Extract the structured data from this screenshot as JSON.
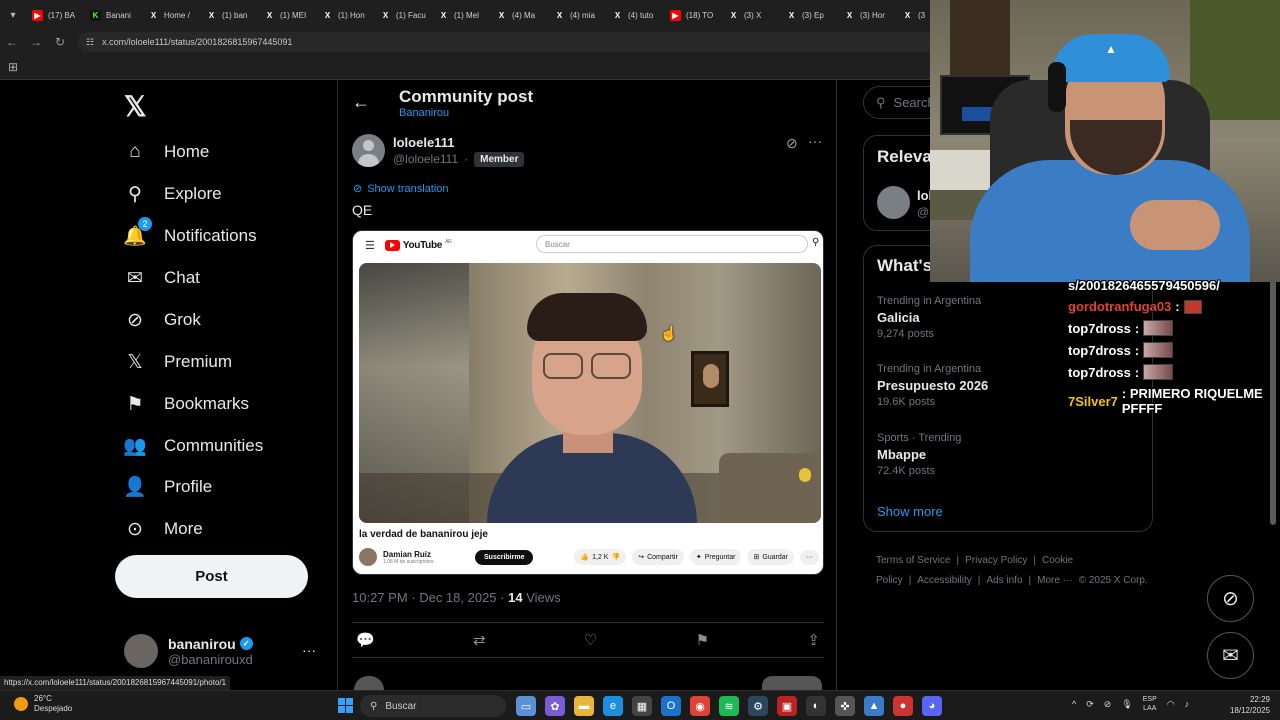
{
  "browser": {
    "tabs": [
      {
        "label": "(17) BA",
        "icon": "youtube-icon",
        "color": "#ff0000"
      },
      {
        "label": "Banani",
        "icon": "kick-icon",
        "color": "#53fc18"
      },
      {
        "label": "Home /",
        "icon": "x-icon",
        "color": "#000000"
      },
      {
        "label": "(1) ban",
        "icon": "x-icon",
        "color": "#000000"
      },
      {
        "label": "(1) MEI",
        "icon": "x-icon",
        "color": "#000000"
      },
      {
        "label": "(1) Hon",
        "icon": "x-icon",
        "color": "#000000"
      },
      {
        "label": "(1) Facu",
        "icon": "x-icon",
        "color": "#000000"
      },
      {
        "label": "(1) Mel",
        "icon": "x-icon",
        "color": "#000000"
      },
      {
        "label": "(4) Ma",
        "icon": "x-icon",
        "color": "#000000"
      },
      {
        "label": "(4) mia",
        "icon": "x-icon",
        "color": "#000000"
      },
      {
        "label": "(4) tuto",
        "icon": "x-icon",
        "color": "#000000"
      },
      {
        "label": "(18) TO",
        "icon": "youtube-icon",
        "color": "#ff0000"
      },
      {
        "label": "(3) X",
        "icon": "x-icon",
        "color": "#000000"
      },
      {
        "label": "(3) Ep",
        "icon": "x-icon",
        "color": "#000000"
      },
      {
        "label": "(3) Hor",
        "icon": "x-icon",
        "color": "#000000"
      },
      {
        "label": "(3",
        "icon": "x-icon",
        "color": "#000000"
      }
    ],
    "url": "x.com/loloele111/status/2001826815967445091",
    "status_url": "https://x.com/loloele111/status/2001826815967445091/photo/1"
  },
  "nav": {
    "items": [
      {
        "label": "Home",
        "icon": "home-icon",
        "glyph": "⌂"
      },
      {
        "label": "Explore",
        "icon": "search-icon",
        "glyph": "⚲"
      },
      {
        "label": "Notifications",
        "icon": "bell-icon",
        "glyph": "🔔",
        "badge": "2"
      },
      {
        "label": "Chat",
        "icon": "mail-icon",
        "glyph": "✉"
      },
      {
        "label": "Grok",
        "icon": "grok-icon",
        "glyph": "⊘"
      },
      {
        "label": "Premium",
        "icon": "x-icon",
        "glyph": "𝕏"
      },
      {
        "label": "Bookmarks",
        "icon": "bookmark-icon",
        "glyph": "⚑"
      },
      {
        "label": "Communities",
        "icon": "communities-icon",
        "glyph": "👥"
      },
      {
        "label": "Profile",
        "icon": "profile-icon",
        "glyph": "👤"
      },
      {
        "label": "More",
        "icon": "more-circle-icon",
        "glyph": "⊙"
      }
    ],
    "post_label": "Post",
    "account": {
      "name": "bananirou",
      "handle": "@bananirouxd"
    }
  },
  "header": {
    "title": "Community post",
    "community": "Bananirou"
  },
  "post": {
    "author_name": "loloele111",
    "author_handle": "@loloele111",
    "separator": "·",
    "member_badge": "Member",
    "translate_label": "Show translation",
    "text": "QE",
    "time": "10:27 PM · Dec 18, 2025 · ",
    "views_count": "14",
    "views_label": "Views"
  },
  "youtube": {
    "logo": "YouTube",
    "region": "AR",
    "search_placeholder": "Buscar",
    "video_title": "la verdad de bananirou jeje",
    "channel": "Damian Ruiz",
    "subscribers": "1,08 M de suscriptores",
    "subscribe": "Suscribirme",
    "likes": "1,2 K",
    "share": "Compartir",
    "ask": "Preguntar",
    "save": "Guardar"
  },
  "sidebar": {
    "search_placeholder": "Search",
    "relevant_title": "Releva",
    "relevant_name": "lol",
    "relevant_handle": "@l",
    "trends_title": "What's",
    "trends": [
      {
        "context": "Trending in Argentina",
        "name": "Galicia",
        "count": "9,274 posts"
      },
      {
        "context": "Trending in Argentina",
        "name": "Presupuesto 2026",
        "count": "19.6K posts"
      },
      {
        "context": "Sports · Trending",
        "name": "Mbappe",
        "count": "72.4K posts"
      }
    ],
    "show_more": "Show more",
    "footer": [
      "Terms of Service",
      "|",
      "Privacy Policy",
      "|",
      "Cookie Policy",
      "|",
      "Accessibility",
      "|",
      "Ads info",
      "|",
      "More ···",
      "© 2025 X Corp."
    ]
  },
  "chat": {
    "lines": [
      {
        "user": "",
        "text": "s/2001826465579450596/"
      },
      {
        "user": "gordotranfuga03",
        "sep": " :",
        "emote": true,
        "user_color": "#e0423a"
      },
      {
        "user": "top7dross",
        "sep": " :",
        "emote": true,
        "user_color": "#ffffff"
      },
      {
        "user": "top7dross",
        "sep": " :",
        "emote": true,
        "user_color": "#ffffff"
      },
      {
        "user": "top7dross",
        "sep": " :",
        "emote": true,
        "user_color": "#ffffff"
      },
      {
        "user": "7Silver7",
        "sep": " : PRIMERO RIQUELME PFFFF",
        "emote": false,
        "user_color": "#f1c40f"
      }
    ]
  },
  "taskbar": {
    "weather_temp": "26°C",
    "weather_desc": "Despejado",
    "search_label": "Buscar",
    "lang_line1": "ESP",
    "lang_line2": "LAA",
    "time": "22:29",
    "date": "18/12/2025"
  },
  "colors": {
    "accent": "#1d9bf0",
    "background": "#000000",
    "verified": "#1d9bf0"
  }
}
